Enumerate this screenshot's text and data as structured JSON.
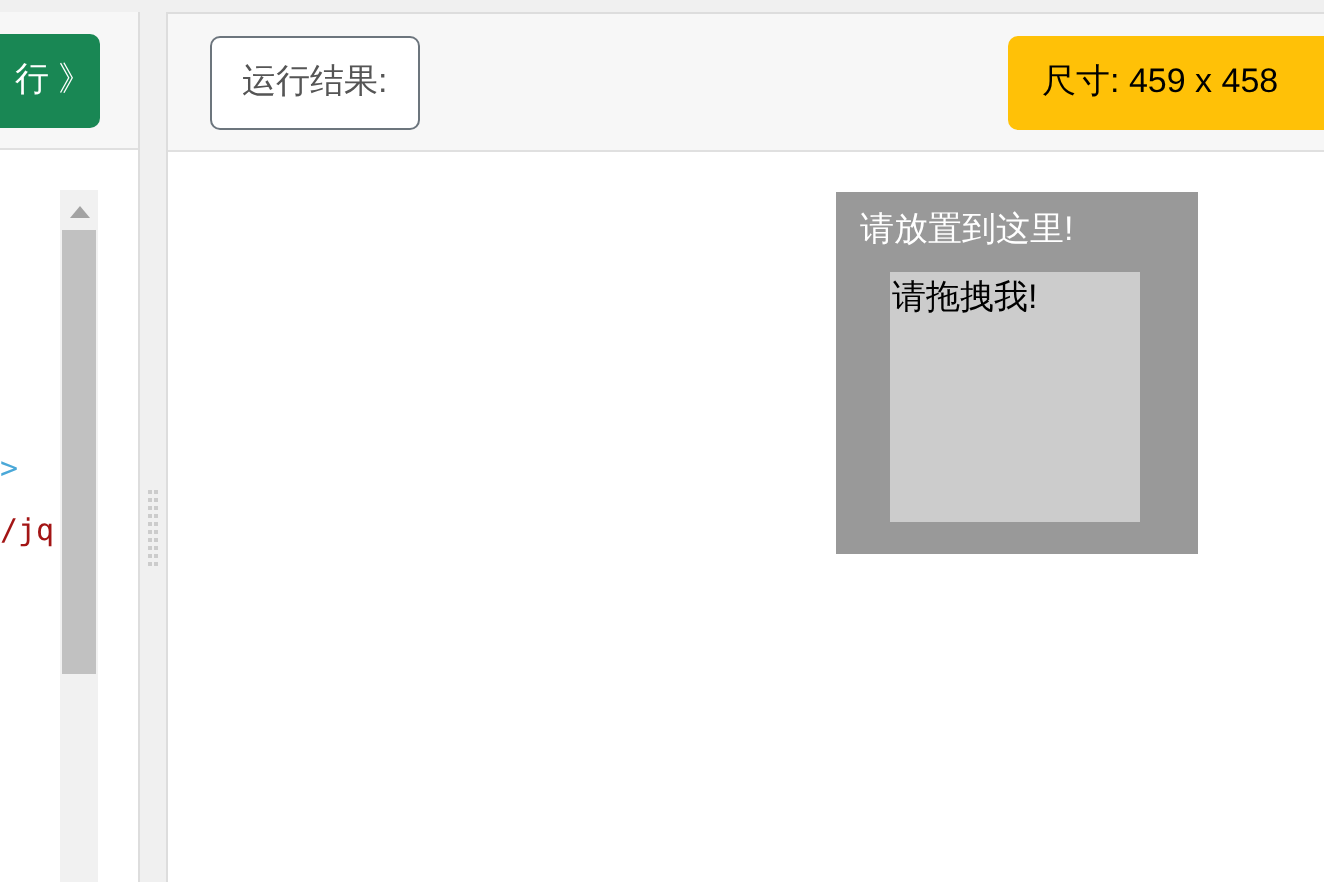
{
  "editor": {
    "run_button": "行 》",
    "code_lines": [
      {
        "kind": "tag-close",
        "text": ">"
      },
      {
        "kind": "tag-path",
        "text": "/jq"
      }
    ]
  },
  "result": {
    "title_button": "运行结果:",
    "size_badge": "尺寸: 459 x 458",
    "drop_zone": {
      "label": "请放置到这里!"
    },
    "drag_item": {
      "label": "请拖拽我!"
    }
  }
}
